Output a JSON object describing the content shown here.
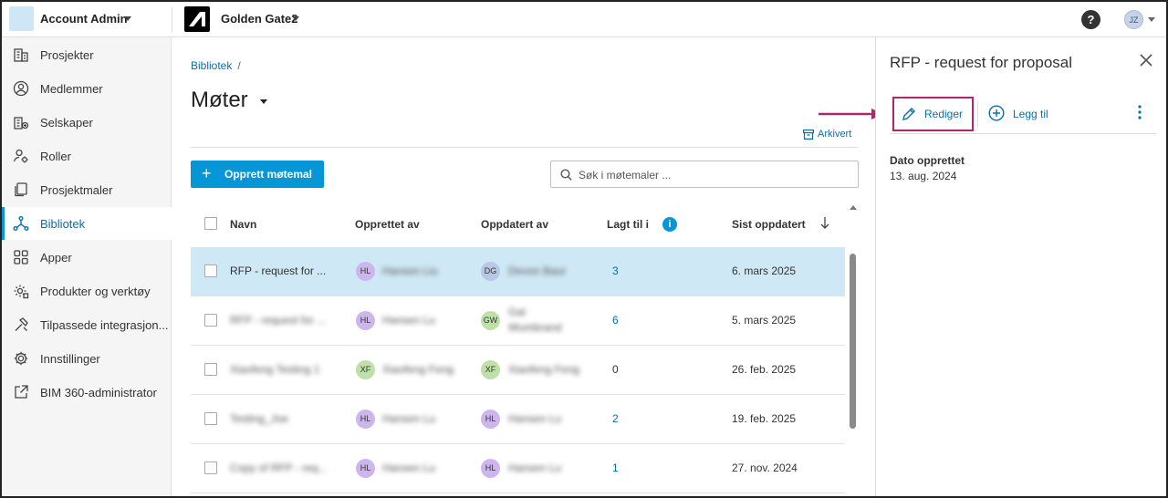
{
  "topbar": {
    "account_name": "Account Admin",
    "project_name": "Golden Gate2",
    "help_label": "?",
    "user_initials": "JZ"
  },
  "sidebar": {
    "items": [
      {
        "label": "Prosjekter",
        "icon": "building-icon",
        "active": false
      },
      {
        "label": "Medlemmer",
        "icon": "person-circle-icon",
        "active": false
      },
      {
        "label": "Selskaper",
        "icon": "company-icon",
        "active": false
      },
      {
        "label": "Roller",
        "icon": "role-gear-icon",
        "active": false
      },
      {
        "label": "Prosjektmaler",
        "icon": "copy-icon",
        "active": false
      },
      {
        "label": "Bibliotek",
        "icon": "library-network-icon",
        "active": true
      },
      {
        "label": "Apper",
        "icon": "grid-apps-icon",
        "active": false
      },
      {
        "label": "Produkter og verktøy",
        "icon": "cog-box-icon",
        "active": false
      },
      {
        "label": "Tilpassede integrasjon...",
        "icon": "hammer-icon",
        "active": false
      },
      {
        "label": "Innstillinger",
        "icon": "settings-gear-icon",
        "active": false
      },
      {
        "label": "BIM 360-administrator",
        "icon": "external-link-icon",
        "active": false
      }
    ]
  },
  "main": {
    "breadcrumb": {
      "root": "Bibliotek",
      "separator": "/"
    },
    "title": "Møter",
    "archived_label": "Arkivert",
    "create_button": "Opprett møtemal",
    "search_placeholder": "Søk i møtemaler ...",
    "columns": {
      "name": "Navn",
      "created_by": "Opprettet av",
      "updated_by": "Oppdatert av",
      "added_to": "Lagt til i",
      "last_updated": "Sist oppdatert"
    },
    "rows": [
      {
        "name": "RFP - request for ...",
        "c_ini": "HL",
        "c_name": "Hansen Liu",
        "c_color": "#cdb6ee",
        "u_ini": "DG",
        "u_name": "Devon Baur",
        "u_name2": "",
        "u_color": "#b8c8e4",
        "added": "3",
        "added_link": true,
        "updated": "6. mars 2025",
        "selected": true,
        "name_blur": false
      },
      {
        "name": "RFP - request for ...",
        "c_ini": "HL",
        "c_name": "Hansen Lu",
        "c_color": "#cdb6ee",
        "u_ini": "GW",
        "u_name": "Gal",
        "u_name2": "Wumbrand",
        "u_color": "#bfe0a8",
        "added": "6",
        "added_link": true,
        "updated": "5. mars 2025",
        "selected": false,
        "name_blur": true
      },
      {
        "name": "Xiaofeng Testing 1",
        "c_ini": "XF",
        "c_name": "Xiaofeng Feng",
        "c_color": "#bfe0a8",
        "u_ini": "XF",
        "u_name": "Xiaofeng Feng",
        "u_name2": "",
        "u_color": "#bfe0a8",
        "added": "0",
        "added_link": false,
        "updated": "26. feb. 2025",
        "selected": false,
        "name_blur": true
      },
      {
        "name": "Testing_Joe",
        "c_ini": "HL",
        "c_name": "Hansen Lu",
        "c_color": "#cdb6ee",
        "u_ini": "HL",
        "u_name": "Hansen Lu",
        "u_name2": "",
        "u_color": "#cdb6ee",
        "added": "2",
        "added_link": true,
        "updated": "19. feb. 2025",
        "selected": false,
        "name_blur": true
      },
      {
        "name": "Copy of RFP - req...",
        "c_ini": "HL",
        "c_name": "Hansen Lu",
        "c_color": "#cdb6ee",
        "u_ini": "HL",
        "u_name": "Hansen Lu",
        "u_name2": "",
        "u_color": "#cdb6ee",
        "added": "1",
        "added_link": true,
        "updated": "27. nov. 2024",
        "selected": false,
        "name_blur": true
      }
    ]
  },
  "panel": {
    "title": "RFP - request for proposal",
    "edit_label": "Rediger",
    "add_label": "Legg til",
    "meta_label": "Dato opprettet",
    "meta_value": "13. aug. 2024"
  },
  "colors": {
    "accent": "#0696d7",
    "link": "#0a6ea8",
    "selected_row": "#cfe8f5",
    "annotation": "#b0266d"
  }
}
